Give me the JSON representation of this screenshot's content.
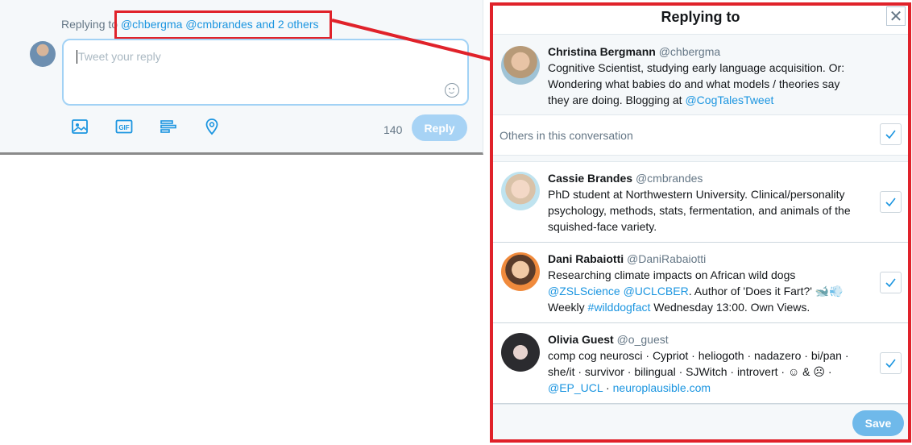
{
  "composer": {
    "replying_prefix": "Replying to",
    "reply_handles": "@chbergma @cmbrandes and 2 others",
    "placeholder": "Tweet your reply",
    "char_count": "140",
    "reply_label": "Reply",
    "tools": [
      "image-icon",
      "gif-icon",
      "poll-icon",
      "location-icon"
    ]
  },
  "modal": {
    "title": "Replying to",
    "close_glyph": "✕",
    "others_label": "Others in this conversation",
    "save_label": "Save",
    "primary": {
      "name": "Christina Bergmann",
      "handle": "@chbergma",
      "bio": "Cognitive Scientist, studying early language acquisition. Or: Wondering what babies do and what models / theories say they are doing. Blogging at ",
      "bio_link": "@CogTalesTweet"
    },
    "people": [
      {
        "name": "Cassie Brandes",
        "handle": "@cmbrandes",
        "bio": "PhD student at Northwestern University. Clinical/personality psychology, methods, stats, fermentation, and animals of the squished-face variety.",
        "checked": true
      },
      {
        "name": "Dani Rabaiotti",
        "handle": "@DaniRabaiotti",
        "bio_1": "Researching climate impacts on African wild dogs ",
        "link_1": "@ZSLScience",
        "link_2": "@UCLCBER",
        "bio_2": ". Author of 'Does it Fart?' 🐋💨",
        "bio_3": "Weekly ",
        "link_3": "#wilddogfact",
        "bio_4": " Wednesday 13:00. Own Views.",
        "checked": true
      },
      {
        "name": "Olivia Guest",
        "handle": "@o_guest",
        "bio_1": "comp cog neurosci · Cypriot · heliogoth · nadazero · bi/pan · she/it · survivor · bilingual · SJWitch · introvert · ☺ & ☹ · ",
        "link_1": "@EP_UCL",
        "sep": " · ",
        "link_2": "neuroplausible.com",
        "checked": true
      }
    ]
  },
  "colors": {
    "accent": "#1b95e0",
    "highlight_red": "#e0222a",
    "reply_disabled": "#a7d3f5"
  }
}
